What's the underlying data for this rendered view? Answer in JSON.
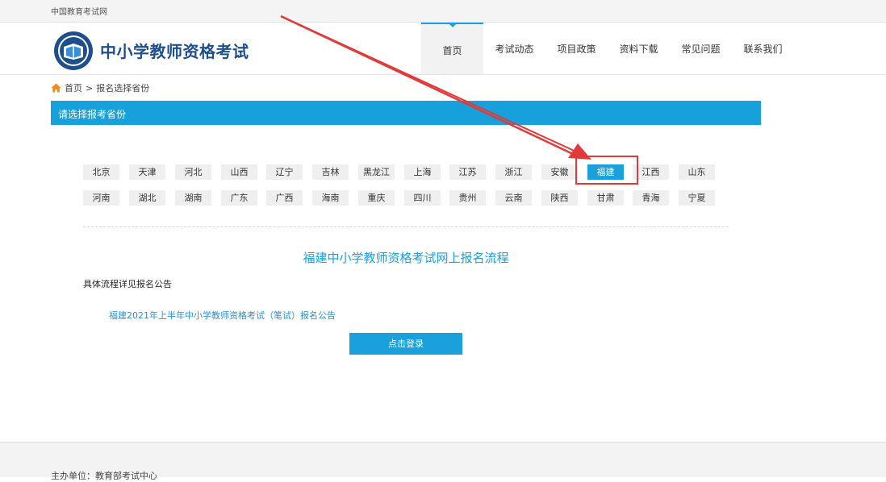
{
  "topbar": {
    "site_name": "中国教育考试网"
  },
  "header": {
    "title": "中小学教师资格考试",
    "nav": [
      {
        "label": "首页",
        "active": true
      },
      {
        "label": "考试动态",
        "active": false
      },
      {
        "label": "项目政策",
        "active": false
      },
      {
        "label": "资料下载",
        "active": false
      },
      {
        "label": "常见问题",
        "active": false
      },
      {
        "label": "联系我们",
        "active": false
      }
    ]
  },
  "breadcrumb": {
    "home": "首页",
    "separator": ">",
    "current": "报名选择省份"
  },
  "section": {
    "title": "请选择报考省份"
  },
  "provinces": {
    "row1": [
      "北京",
      "天津",
      "河北",
      "山西",
      "辽宁",
      "吉林",
      "黑龙江",
      "上海",
      "江苏",
      "浙江",
      "安徽",
      "福建",
      "江西",
      "山东"
    ],
    "row2": [
      "河南",
      "湖北",
      "湖南",
      "广东",
      "广西",
      "海南",
      "重庆",
      "四川",
      "贵州",
      "云南",
      "陕西",
      "甘肃",
      "青海",
      "宁夏"
    ],
    "selected": "福建"
  },
  "flow": {
    "title": "福建中小学教师资格考试网上报名流程",
    "note": "具体流程详见报名公告",
    "notice_link": "福建2021年上半年中小学教师资格考试（笔试）报名公告",
    "login_button": "点击登录"
  },
  "footer": {
    "organizer": "主办单位：教育部考试中心"
  },
  "colors": {
    "accent": "#1aa0dc",
    "annotation": "#e03a3a",
    "brand": "#1f4e8c"
  }
}
